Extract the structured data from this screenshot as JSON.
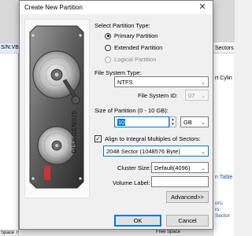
{
  "background": {
    "left_row_text": "S/N:VB",
    "right_header": "Sectors",
    "right_cyl": "rt Cylin",
    "right_table": "n Table S",
    "right_list": [
      "ors:",
      "rs:",
      "Sector"
    ],
    "bottom_left": "Space Type",
    "bottom_mid": "Free Space"
  },
  "dialog": {
    "title": "Create New Partition",
    "close_glyph": "✕",
    "logo_text": "DISKGENIUS",
    "partition_type_label": "Select Partition Type:",
    "partition_types": [
      {
        "label": "Primary Partition",
        "selected": true,
        "enabled": true
      },
      {
        "label": "Extended Partition",
        "selected": false,
        "enabled": true
      },
      {
        "label": "Logical Partition",
        "selected": false,
        "enabled": false
      }
    ],
    "fs_type_label": "File System Type:",
    "fs_type_value": "NTFS",
    "fs_id_label": "File System ID:",
    "fs_id_value": "07",
    "size_label": "Size of Partition (0 - 10 GB):",
    "size_value": "10",
    "size_unit": "GB",
    "align_label": "Align to Integral Multiples of Sectors:",
    "align_checked": true,
    "align_value": "2048 Sector (1048576 Byte)",
    "cluster_label": "Cluster Size:",
    "cluster_value": "Default(4096)",
    "volume_label": "Volume Label:",
    "volume_value": "",
    "advanced_button": "Advanced>>",
    "ok_button": "OK",
    "cancel_button": "Cancel"
  },
  "colors": {
    "accent": "#0078d7",
    "dialog_bg": "#f0f0f0"
  }
}
